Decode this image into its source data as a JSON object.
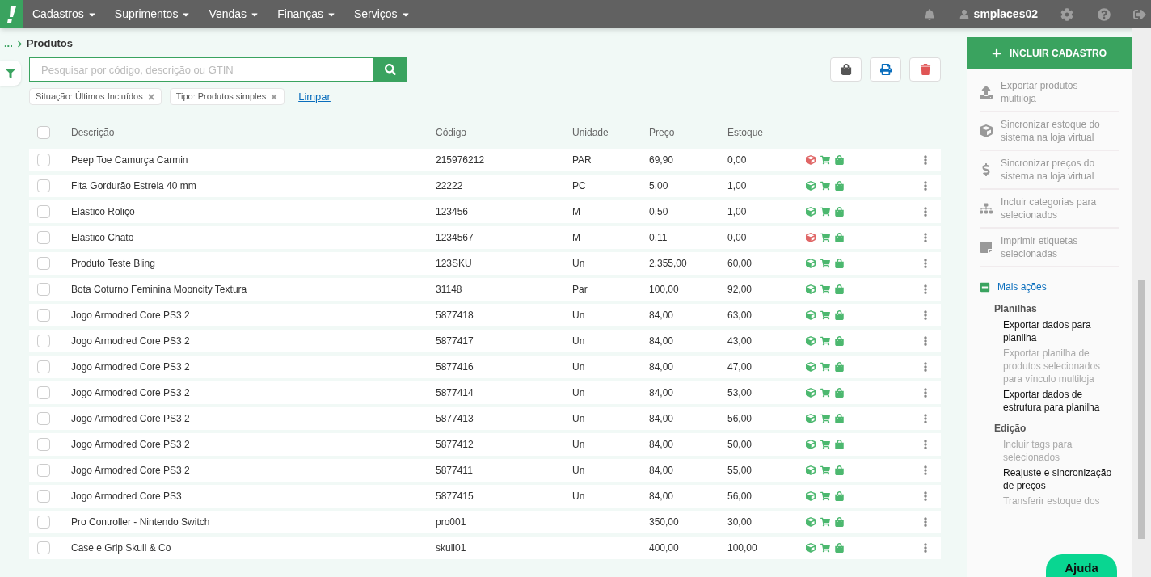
{
  "topbar": {
    "menus": [
      {
        "label": "Cadastros"
      },
      {
        "label": "Suprimentos"
      },
      {
        "label": "Vendas"
      },
      {
        "label": "Finanças"
      },
      {
        "label": "Serviços"
      }
    ],
    "user": "smplaces02"
  },
  "breadcrumb": {
    "ellipsis": "...",
    "current": "Produtos"
  },
  "search": {
    "placeholder": "Pesquisar por código, descrição ou GTIN"
  },
  "filters": [
    {
      "label": "Situação: Últimos Incluídos"
    },
    {
      "label": "Tipo: Produtos simples"
    }
  ],
  "clear_link": "Limpar",
  "table": {
    "select_all_checked": false,
    "columns": [
      "Descrição",
      "Código",
      "Unidade",
      "Preço",
      "Estoque"
    ],
    "rows": [
      {
        "description": "Peep Toe Camurça Carmin",
        "code": "215976212",
        "unit": "PAR",
        "price": "69,90",
        "stock": "0,00",
        "color": "#e06666",
        "checked": false
      },
      {
        "description": "Fita Gordurão Estrela 40 mm",
        "code": "22222",
        "unit": "PC",
        "price": "5,00",
        "stock": "1,00",
        "color": "#4cb86f",
        "checked": false
      },
      {
        "description": "Elástico Roliço",
        "code": "123456",
        "unit": "M",
        "price": "0,50",
        "stock": "1,00",
        "color": "#4cb86f",
        "checked": false
      },
      {
        "description": "Elástico Chato",
        "code": "1234567",
        "unit": "M",
        "price": "0,11",
        "stock": "0,00",
        "color": "#e06666",
        "checked": false
      },
      {
        "description": "Produto Teste Bling",
        "code": "123SKU",
        "unit": "Un",
        "price": "2.355,00",
        "stock": "60,00",
        "color": "#4cb86f",
        "checked": false
      },
      {
        "description": "Bota Coturno Feminina Mooncity Textura",
        "code": "31148",
        "unit": "Par",
        "price": "100,00",
        "stock": "92,00",
        "color": "#4cb86f",
        "checked": false
      },
      {
        "description": "Jogo Armodred Core PS3 2",
        "code": "5877418",
        "unit": "Un",
        "price": "84,00",
        "stock": "63,00",
        "color": "#4cb86f",
        "checked": false
      },
      {
        "description": "Jogo Armodred Core PS3 2",
        "code": "5877417",
        "unit": "Un",
        "price": "84,00",
        "stock": "43,00",
        "color": "#4cb86f",
        "checked": false
      },
      {
        "description": "Jogo Armodred Core PS3 2",
        "code": "5877416",
        "unit": "Un",
        "price": "84,00",
        "stock": "47,00",
        "color": "#4cb86f",
        "checked": false
      },
      {
        "description": "Jogo Armodred Core PS3 2",
        "code": "5877414",
        "unit": "Un",
        "price": "84,00",
        "stock": "53,00",
        "color": "#4cb86f",
        "checked": false
      },
      {
        "description": "Jogo Armodred Core PS3 2",
        "code": "5877413",
        "unit": "Un",
        "price": "84,00",
        "stock": "56,00",
        "color": "#4cb86f",
        "checked": false
      },
      {
        "description": "Jogo Armodred Core PS3 2",
        "code": "5877412",
        "unit": "Un",
        "price": "84,00",
        "stock": "50,00",
        "color": "#4cb86f",
        "checked": false
      },
      {
        "description": "Jogo Armodred Core PS3 2",
        "code": "5877411",
        "unit": "Un",
        "price": "84,00",
        "stock": "55,00",
        "color": "#4cb86f",
        "checked": false
      },
      {
        "description": "Jogo Armodred Core PS3",
        "code": "5877415",
        "unit": "Un",
        "price": "84,00",
        "stock": "56,00",
        "color": "#4cb86f",
        "checked": false
      },
      {
        "description": "Pro Controller - Nintendo Switch",
        "code": "pro001",
        "price": "350,00",
        "stock": "30,00",
        "color": "#4cb86f",
        "checked": false
      },
      {
        "description": "Case e Grip Skull & Co",
        "code": "skull01",
        "price": "400,00",
        "stock": "100,00",
        "color": "#4cb86f",
        "checked": false
      }
    ]
  },
  "side_panel": {
    "primary_button": "INCLUIR CADASTRO",
    "actions": [
      {
        "kind": "upload",
        "label": "Exportar produtos multiloja"
      },
      {
        "kind": "cube",
        "label": "Sincronizar estoque do sistema na loja virtual"
      },
      {
        "kind": "dollar",
        "label": "Sincronizar preços do sistema na loja virtual"
      },
      {
        "kind": "sitemap",
        "label": "Incluir categorias para selecionados"
      },
      {
        "kind": "note",
        "label": "Imprimir etiquetas selecionadas"
      }
    ],
    "more": {
      "label": "Mais ações",
      "expanded": true,
      "groups": [
        {
          "title": "Planilhas",
          "items": [
            {
              "label": "Exportar dados para planilha",
              "disabled": false
            },
            {
              "label": "Exportar planilha de produtos selecionados para vínculo multiloja",
              "disabled": true
            },
            {
              "label": "Exportar dados de estrutura para planilha",
              "disabled": false
            }
          ]
        },
        {
          "title": "Edição",
          "items": [
            {
              "label": "Incluir tags para selecionados",
              "disabled": true
            },
            {
              "label": "Reajuste e sincronização de preços",
              "disabled": false
            },
            {
              "label": "Transferir estoque dos",
              "disabled": true
            }
          ]
        }
      ]
    }
  },
  "help_button": "Ajuda"
}
